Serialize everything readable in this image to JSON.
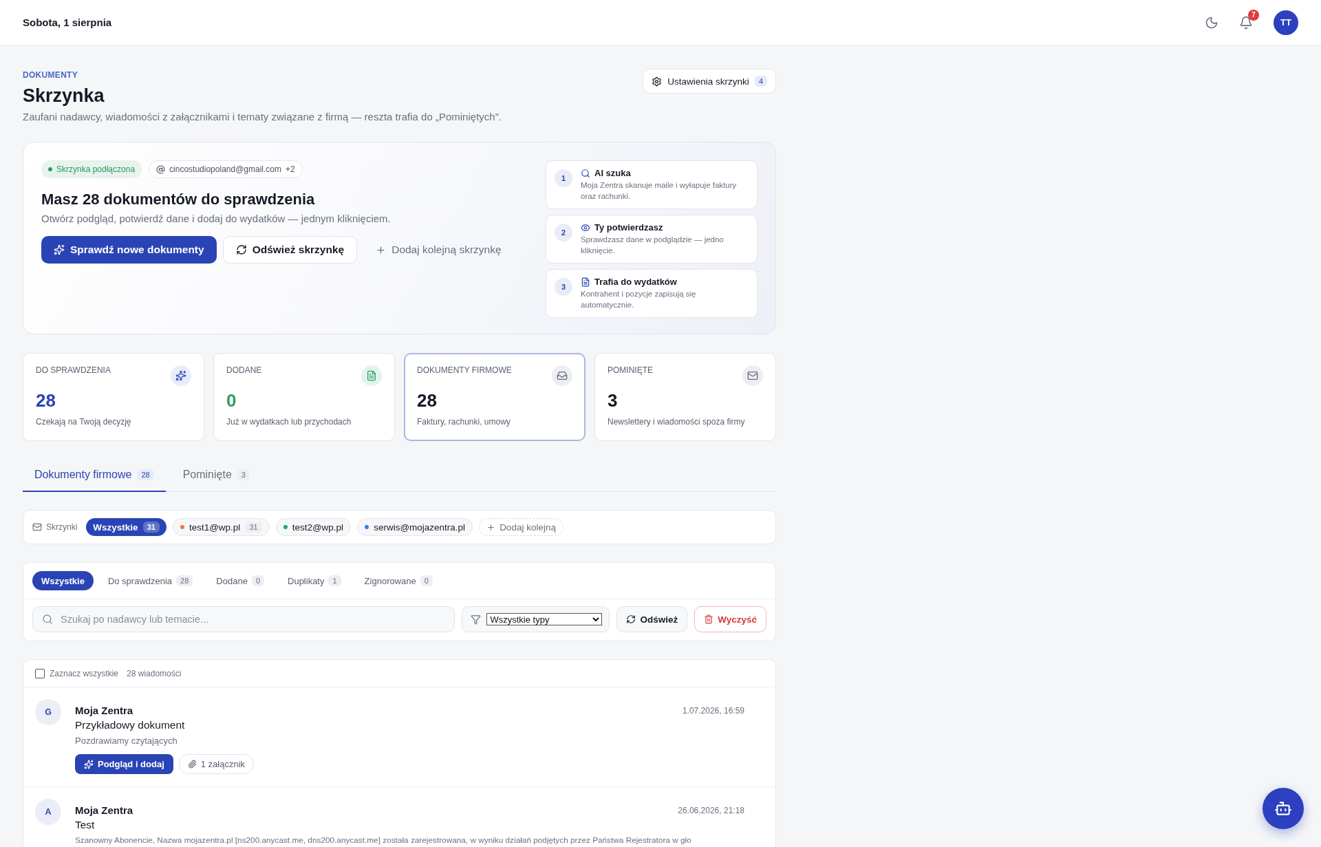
{
  "header": {
    "date": "Sobota, 1 sierpnia",
    "notifications": "7",
    "avatar": "TT"
  },
  "page": {
    "eyebrow": "DOKUMENTY",
    "title": "Skrzynka",
    "subtitle": "Zaufani nadawcy, wiadomości z załącznikami i tematy związane z firmą — reszta trafia do „Pominiętych”.",
    "settings_button": {
      "label": "Ustawienia skrzynki",
      "count": "4"
    }
  },
  "hero": {
    "status": "Skrzynka podłączona",
    "account": "cincostudiopoland@gmail.com",
    "account_extra": "+2",
    "heading": "Masz 28 dokumentów do sprawdzenia",
    "text": "Otwórz podgląd, potwierdź dane i dodaj do wydatków — jednym kliknięciem.",
    "buttons": [
      {
        "kind": "primary",
        "label": "Sprawdź nowe dokumenty"
      },
      {
        "kind": "secondary",
        "label": "Odśwież skrzynkę"
      },
      {
        "kind": "link",
        "label": "Dodaj kolejną skrzynkę"
      }
    ],
    "steps": [
      {
        "kind": "search",
        "number": "1",
        "title": "AI szuka",
        "text": "Moja Zentra skanuje maile i wyłapuje faktury oraz rachunki."
      },
      {
        "kind": "review",
        "number": "2",
        "title": "Ty potwierdzasz",
        "text": "Sprawdzasz dane w podglądzie — jedno kliknięcie."
      },
      {
        "kind": "document",
        "number": "3",
        "title": "Trafia do wydatków",
        "text": "Kontrahent i pozycje zapisują się automatycznie."
      }
    ]
  },
  "stats": [
    {
      "kind": "sparkle",
      "label": "DO SPRAWDZENIA",
      "value": "28",
      "caption": "Czekają na Twoją decyzję",
      "color": "#2a44b5",
      "selected": false
    },
    {
      "kind": "document",
      "label": "DODANE",
      "value": "0",
      "caption": "Już w wydatkach lub przychodach",
      "color": "#2f9e63",
      "selected": false
    },
    {
      "kind": "inbox",
      "label": "DOKUMENTY FIRMOWE",
      "value": "28",
      "caption": "Faktury, rachunki, umowy",
      "color": "#161a26",
      "selected": true
    },
    {
      "kind": "mail",
      "label": "POMINIĘTE",
      "value": "3",
      "caption": "Newslettery i wiadomości spoza firmy",
      "color": "#161a26",
      "selected": false
    }
  ],
  "tabs": [
    {
      "label": "Dokumenty firmowe",
      "count": "28",
      "selected": true
    },
    {
      "label": "Pominięte",
      "count": "3",
      "selected": false
    }
  ],
  "mailboxes": {
    "label": "Skrzynki",
    "items": [
      {
        "label": "Wszystkie",
        "count": "31",
        "selected": true
      },
      {
        "label": "test1@wp.pl",
        "color": "#f07828",
        "count": "31",
        "selected": false
      },
      {
        "label": "test2@wp.pl",
        "color": "#1fa86b",
        "selected": false
      },
      {
        "label": "serwis@mojazentra.pl",
        "color": "#3b7de8",
        "selected": false
      }
    ],
    "add": "Dodaj kolejną"
  },
  "status_filters": [
    {
      "label": "Wszystkie",
      "selected": true
    },
    {
      "label": "Do sprawdzenia",
      "count": "28",
      "selected": false
    },
    {
      "label": "Dodane",
      "count": "0",
      "selected": false
    },
    {
      "label": "Duplikaty",
      "count": "1",
      "selected": false
    },
    {
      "label": "Zignorowane",
      "count": "0",
      "selected": false
    }
  ],
  "search": {
    "placeholder": "Szukaj po nadawcy lub temacie..."
  },
  "type_filter": {
    "value": "Wszystkie typy"
  },
  "refresh": "Odśwież",
  "clear": "Wyczyść",
  "list": {
    "select_all": {
      "label": "Zaznacz wszystkie",
      "checked": false
    },
    "count": "28 wiadomości",
    "messages": [
      {
        "avatar": "G",
        "sender": "Moja Zentra",
        "subject": "Przykładowy dokument",
        "snippet": "Pozdrawiamy czytających",
        "date": "1.07.2026, 16:59",
        "action": "Podgląd i dodaj",
        "attachments": "1 załącznik"
      },
      {
        "avatar": "A",
        "sender": "Moja Zentra",
        "subject": "Test",
        "snippet": "Szanowny Abonencie, Nazwa mojazentra.pl [ns200.anycast.me, dns200.anycast.me] została zarejestrowana, w wyniku działań podjętych przez Państwa Rejestratora w gło",
        "date": "26.06.2026, 21:18"
      }
    ]
  }
}
